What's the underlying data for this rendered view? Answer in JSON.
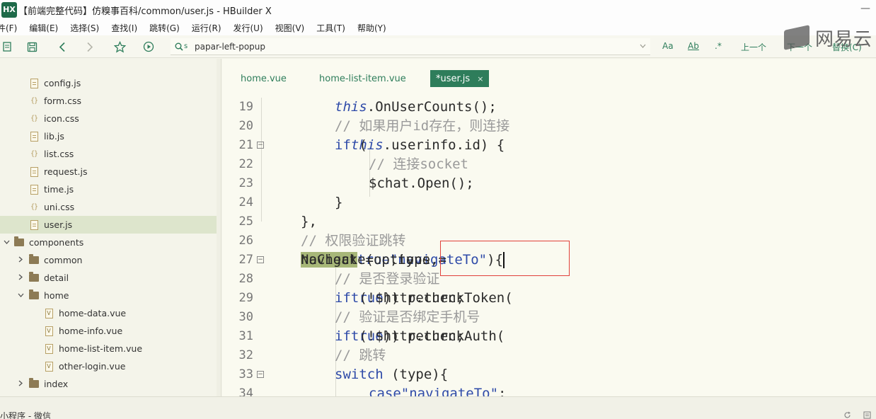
{
  "window": {
    "app_logo": "HX",
    "title": "【前端完整代码】仿糗事百科/common/user.js - HBuilder X",
    "minimize_label": "—"
  },
  "menu": [
    "件(F)",
    "编辑(E)",
    "选择(S)",
    "查找(I)",
    "跳转(G)",
    "运行(R)",
    "发行(U)",
    "视图(V)",
    "工具(T)",
    "帮助(Y)"
  ],
  "toolbar": {
    "icons": [
      "files-icon",
      "save-icon",
      "back-icon",
      "forward-icon",
      "bookmark-star-icon",
      "run-icon"
    ],
    "search_value": "papar-left-popup",
    "search_icon_label": "s",
    "options": [
      "Aa",
      "Ab",
      ".*"
    ],
    "prev_label": "上一个",
    "next_label": "下一个",
    "replace_label": "替换(C)"
  },
  "watermark": {
    "text": "网易云"
  },
  "sidebar": {
    "items": [
      {
        "label": "config.js",
        "type": "js",
        "depth": 2
      },
      {
        "label": "form.css",
        "type": "css",
        "depth": 2
      },
      {
        "label": "icon.css",
        "type": "css",
        "depth": 2
      },
      {
        "label": "lib.js",
        "type": "js",
        "depth": 2
      },
      {
        "label": "list.css",
        "type": "css",
        "depth": 2
      },
      {
        "label": "request.js",
        "type": "js",
        "depth": 2
      },
      {
        "label": "time.js",
        "type": "js",
        "depth": 2
      },
      {
        "label": "uni.css",
        "type": "css",
        "depth": 2
      },
      {
        "label": "user.js",
        "type": "js",
        "depth": 2,
        "selected": true
      },
      {
        "label": "components",
        "type": "folder",
        "depth": 0,
        "expanded": true
      },
      {
        "label": "common",
        "type": "folder",
        "depth": 1,
        "expanded": false
      },
      {
        "label": "detail",
        "type": "folder",
        "depth": 1,
        "expanded": false
      },
      {
        "label": "home",
        "type": "folder",
        "depth": 1,
        "expanded": true
      },
      {
        "label": "home-data.vue",
        "type": "vue",
        "depth": 3
      },
      {
        "label": "home-info.vue",
        "type": "vue",
        "depth": 3
      },
      {
        "label": "home-list-item.vue",
        "type": "vue",
        "depth": 3
      },
      {
        "label": "other-login.vue",
        "type": "vue",
        "depth": 3
      },
      {
        "label": "index",
        "type": "folder",
        "depth": 1,
        "expanded": false
      }
    ]
  },
  "tabs": [
    {
      "label": "home.vue",
      "active": false
    },
    {
      "label": "home-list-item.vue",
      "active": false
    },
    {
      "label": "*user.js",
      "active": true,
      "close": "×"
    }
  ],
  "code_lines": [
    {
      "num": "19",
      "indent": 2,
      "fold": false,
      "tokens": [
        [
          "this",
          "this"
        ],
        [
          "src",
          ".OnUserCounts();"
        ]
      ]
    },
    {
      "num": "20",
      "indent": 2,
      "fold": false,
      "tokens": [
        [
          "cm",
          "// 如果用户id存在，则连接"
        ]
      ]
    },
    {
      "num": "21",
      "indent": 2,
      "fold": true,
      "tokens": [
        [
          "kw",
          "if"
        ],
        [
          "src",
          " ("
        ],
        [
          "this",
          "this"
        ],
        [
          "src",
          ".userinfo.id) {"
        ]
      ]
    },
    {
      "num": "22",
      "indent": 3,
      "fold": false,
      "tokens": [
        [
          "cm",
          "// 连接socket"
        ]
      ]
    },
    {
      "num": "23",
      "indent": 3,
      "fold": false,
      "tokens": [
        [
          "src",
          "$chat.Open();"
        ]
      ]
    },
    {
      "num": "24",
      "indent": 2,
      "fold": false,
      "tokens": [
        [
          "src",
          "}"
        ]
      ]
    },
    {
      "num": "25",
      "indent": 1,
      "fold": false,
      "tokens": [
        [
          "src",
          "},"
        ]
      ]
    },
    {
      "num": "26",
      "indent": 1,
      "fold": false,
      "tokens": [
        [
          "cm",
          "// 权限验证跳转"
        ]
      ]
    },
    {
      "num": "27",
      "indent": 1,
      "fold": true,
      "tokens": [
        [
          "src",
          "navigate(options,"
        ],
        [
          "hl",
          "NoCheck"
        ],
        [
          "src",
          " = "
        ],
        [
          "bool",
          "true"
        ],
        [
          "src",
          ",type = "
        ],
        [
          "str",
          "\"navigateTo\""
        ],
        [
          "src",
          "){"
        ]
      ]
    },
    {
      "num": "28",
      "indent": 2,
      "fold": false,
      "tokens": [
        [
          "cm",
          "// 是否登录验证"
        ]
      ]
    },
    {
      "num": "29",
      "indent": 2,
      "fold": false,
      "tokens": [
        [
          "kw",
          "if"
        ],
        [
          "src",
          " (!$http.checkToken("
        ],
        [
          "bool",
          "true"
        ],
        [
          "src",
          ")) return;"
        ]
      ]
    },
    {
      "num": "30",
      "indent": 2,
      "fold": false,
      "tokens": [
        [
          "cm",
          "// 验证是否绑定手机号"
        ]
      ]
    },
    {
      "num": "31",
      "indent": 2,
      "fold": false,
      "tokens": [
        [
          "kw",
          "if"
        ],
        [
          "src",
          " (!$http.checkAuth("
        ],
        [
          "bool",
          "true"
        ],
        [
          "src",
          ")) return;"
        ]
      ]
    },
    {
      "num": "32",
      "indent": 2,
      "fold": false,
      "tokens": [
        [
          "cm",
          "// 跳转"
        ]
      ]
    },
    {
      "num": "33",
      "indent": 2,
      "fold": true,
      "tokens": [
        [
          "kw",
          "switch"
        ],
        [
          "src",
          " (type){"
        ]
      ]
    },
    {
      "num": "34",
      "indent": 3,
      "fold": false,
      "tokens": [
        [
          "kw",
          "case"
        ],
        [
          "src",
          " "
        ],
        [
          "str",
          "\"navigateTo\""
        ],
        [
          "src",
          ":"
        ]
      ]
    }
  ],
  "status": {
    "text": "小程序 - 微信"
  },
  "colors": {
    "accent": "#2e7d5b",
    "highlight": "#a7b778",
    "redbox": "#e0403a"
  }
}
